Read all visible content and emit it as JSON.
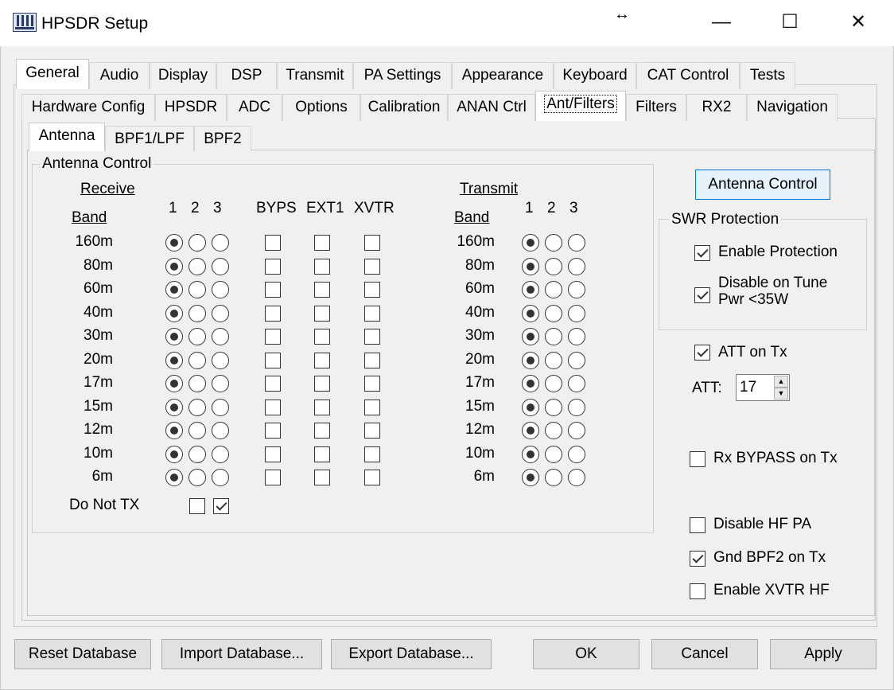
{
  "window": {
    "title": "HPSDR Setup",
    "minimize": "—",
    "maximize": "☐",
    "close": "✕",
    "resize_glyph": "↔"
  },
  "main_tabs": [
    "General",
    "Audio",
    "Display",
    "DSP",
    "Transmit",
    "PA Settings",
    "Appearance",
    "Keyboard",
    "CAT Control",
    "Tests"
  ],
  "sub_tabs": [
    "Hardware Config",
    "HPSDR",
    "ADC",
    "Options",
    "Calibration",
    "ANAN Ctrl",
    "Ant/Filters",
    "Filters",
    "RX2",
    "Navigation"
  ],
  "inner_tabs": [
    "Antenna",
    "BPF1/LPF",
    "BPF2"
  ],
  "antenna_control": {
    "group_title": "Antenna Control",
    "receive_title": "Receive",
    "transmit_title": "Transmit",
    "band_header": "Band",
    "cols_123": [
      "1",
      "2",
      "3"
    ],
    "extra_cols": [
      "BYPS",
      "EXT1",
      "XVTR"
    ],
    "bands": [
      "160m",
      "80m",
      "60m",
      "40m",
      "30m",
      "20m",
      "17m",
      "15m",
      "12m",
      "10m",
      "6m"
    ],
    "rx_selected": [
      1,
      1,
      1,
      1,
      1,
      1,
      1,
      1,
      1,
      1,
      1
    ],
    "tx_selected": [
      1,
      1,
      1,
      1,
      1,
      1,
      1,
      1,
      1,
      1,
      1
    ],
    "do_not_tx_label": "Do Not TX",
    "do_not_tx": [
      false,
      true
    ]
  },
  "right_panel": {
    "antenna_control_button": "Antenna Control",
    "swr_title": "SWR Protection",
    "enable_protection": {
      "label": "Enable Protection",
      "checked": true
    },
    "disable_on_tune": {
      "label_line1": "Disable on Tune",
      "label_line2": "Pwr <35W",
      "checked": true
    },
    "att_on_tx": {
      "label": "ATT on Tx",
      "checked": true
    },
    "att_label": "ATT:",
    "att_value": "17",
    "rx_bypass": {
      "label": "Rx BYPASS on Tx",
      "checked": false
    },
    "disable_hf_pa": {
      "label": "Disable HF PA",
      "checked": false
    },
    "gnd_bpf2": {
      "label": "Gnd BPF2 on Tx",
      "checked": true
    },
    "enable_xvtr_hf": {
      "label": "Enable XVTR HF",
      "checked": false
    }
  },
  "buttons": {
    "reset": "Reset Database",
    "import": "Import Database...",
    "export": "Export Database...",
    "ok": "OK",
    "cancel": "Cancel",
    "apply": "Apply"
  }
}
